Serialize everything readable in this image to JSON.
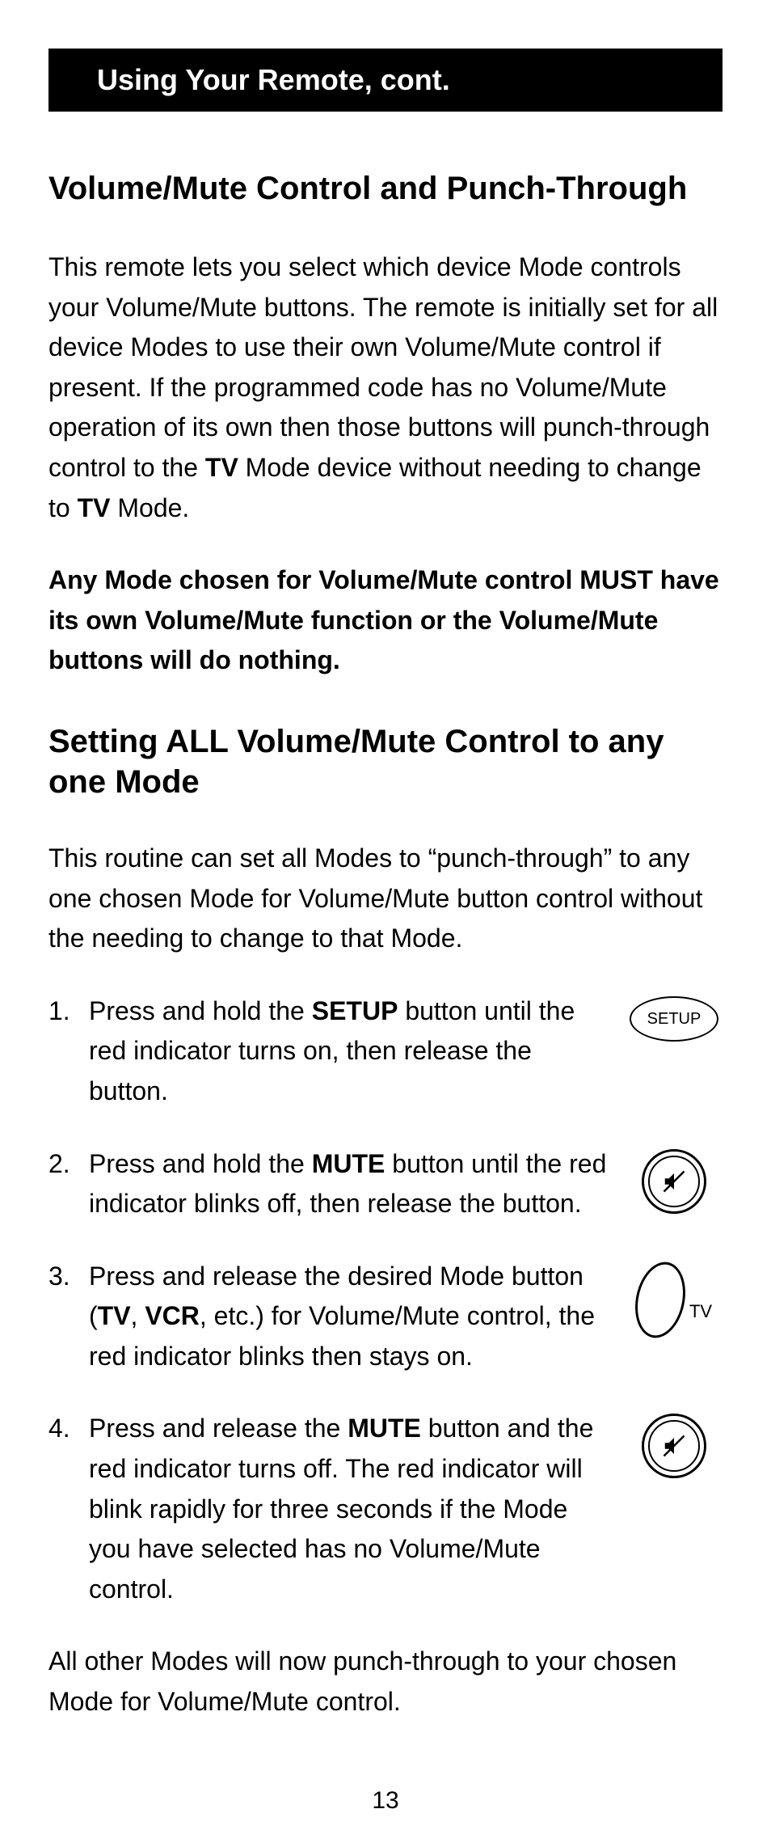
{
  "header": "Using Your Remote, cont.",
  "section1": {
    "title": "Volume/Mute Control and Punch-Through",
    "para_a": "This remote lets you select which device Mode controls your Volume/Mute buttons. The remote is initially set for all device Modes to use their own Volume/Mute control if present. If the programmed code has no Volume/Mute operation of its own then those buttons will punch-through control to the ",
    "para_b": "TV",
    "para_c": " Mode device without needing to change to ",
    "para_d": "TV",
    "para_e": " Mode.",
    "warn": "Any Mode chosen for Volume/Mute control MUST have its own Volume/Mute function or the Volume/Mute buttons will do nothing."
  },
  "section2": {
    "title": "Setting ALL Volume/Mute Control to any one Mode",
    "intro": "This routine can set all Modes to “punch-through” to any one chosen Mode for Volume/Mute button control without the needing to change to that Mode."
  },
  "steps": {
    "s1": {
      "num": "1.",
      "a": "Press and hold the ",
      "b": "SETUP",
      "c": " button until the red indicator turns on, then release the button.",
      "icon_label": "SETUP"
    },
    "s2": {
      "num": "2.",
      "a": "Press and hold the ",
      "b": "MUTE",
      "c": " button until the red indicator blinks off, then release the button."
    },
    "s3": {
      "num": "3.",
      "a": "Press and release the desired Mode button (",
      "b": "TV",
      "c": ", ",
      "d": "VCR",
      "e": ", etc.) for Volume/Mute control, the red indicator blinks then stays on.",
      "tv_label": "TV"
    },
    "s4": {
      "num": "4.",
      "a": "Press and release the ",
      "b": "MUTE",
      "c": " button and the red indicator turns off. The red indicator will blink rapidly for three seconds if the Mode you have selected has no Volume/Mute control."
    }
  },
  "closing": "All other Modes will now punch-through to your chosen Mode for Volume/Mute control.",
  "page_number": "13"
}
